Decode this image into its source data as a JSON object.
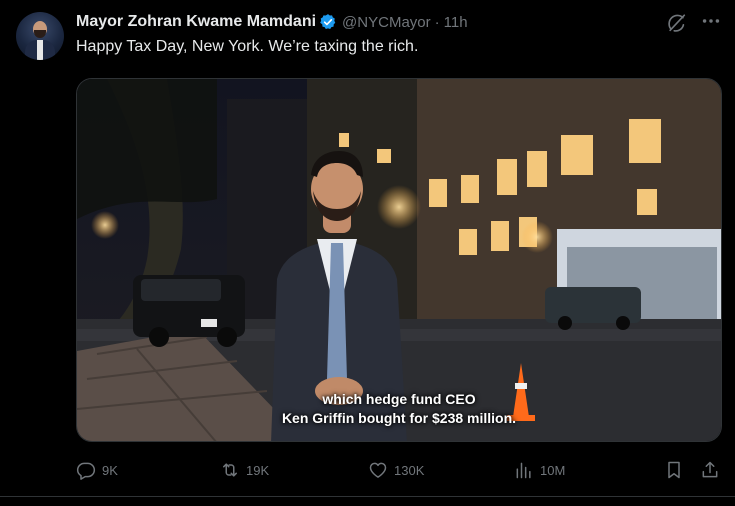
{
  "author": {
    "name": "Mayor Zohran Kwame Mamdani",
    "handle": "@NYCMayor",
    "separator": "·",
    "time": "11h",
    "verified": true,
    "verified_color": "#1d9bf0"
  },
  "tweet": {
    "text": "Happy Tax Day, New York. We’re taxing the rich."
  },
  "media": {
    "caption_line1": "which hedge fund CEO",
    "caption_line2": "Ken Griffin bought for $238 million."
  },
  "actions": {
    "replies": "9K",
    "reposts": "19K",
    "likes": "130K",
    "views": "10M"
  },
  "icons": {
    "grok": "grok-icon",
    "more": "more-icon",
    "reply": "reply-icon",
    "repost": "repost-icon",
    "like": "heart-icon",
    "views": "views-icon",
    "bookmark": "bookmark-icon",
    "share": "share-icon"
  },
  "colors": {
    "background": "#000000",
    "text": "#e7e9ea",
    "muted": "#71767b",
    "accent": "#1d9bf0"
  }
}
